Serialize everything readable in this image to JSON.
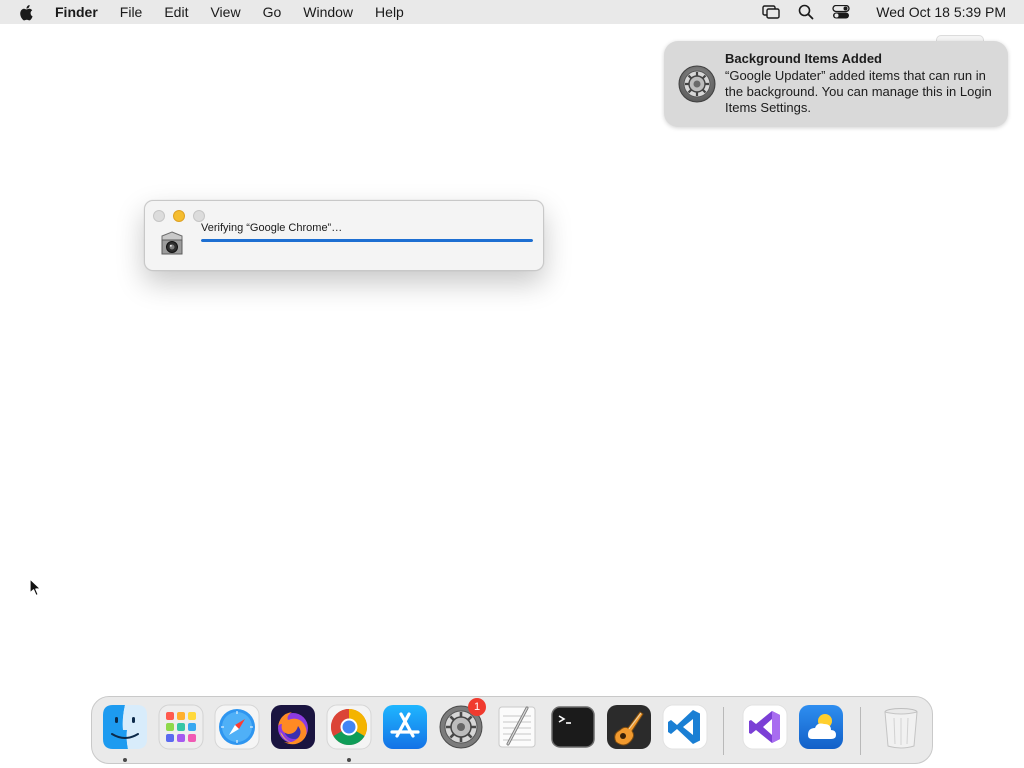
{
  "menubar": {
    "app_name": "Finder",
    "items": [
      "File",
      "Edit",
      "View",
      "Go",
      "Window",
      "Help"
    ],
    "status_icons": [
      "screen-mirroring-icon",
      "spotlight-search-icon",
      "control-center-icon"
    ],
    "clock": "Wed Oct 18  5:39 PM"
  },
  "notification": {
    "title": "Background Items Added",
    "body": "“Google Updater” added items that can run in the background. You can manage this in Login Items Settings.",
    "icon": "system-settings-icon"
  },
  "dialog": {
    "text": "Verifying “Google Chrome”…",
    "progress": 1.0,
    "icon": "gatekeeper-icon",
    "accent_color": "#1d6fd2"
  },
  "dock": {
    "apps": [
      {
        "name": "finder",
        "running": true
      },
      {
        "name": "launchpad",
        "running": false
      },
      {
        "name": "safari",
        "running": false
      },
      {
        "name": "firefox",
        "running": false
      },
      {
        "name": "chrome",
        "running": true
      },
      {
        "name": "app-store",
        "running": false
      },
      {
        "name": "system-settings",
        "running": false,
        "badge": "1"
      },
      {
        "name": "textedit",
        "running": false
      },
      {
        "name": "terminal",
        "running": false
      },
      {
        "name": "garageband",
        "running": false
      },
      {
        "name": "vscode",
        "running": false
      },
      {
        "name": "visual-studio",
        "running": false
      },
      {
        "name": "weather",
        "running": false
      },
      {
        "name": "trash",
        "running": false
      }
    ]
  }
}
